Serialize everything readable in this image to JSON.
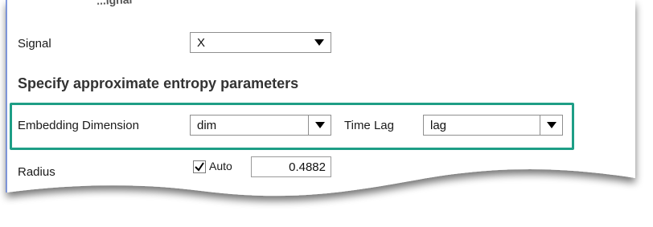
{
  "header": {
    "partial_title": "...ignal"
  },
  "signal": {
    "label": "Signal",
    "value": "X"
  },
  "section": {
    "title": "Specify approximate entropy parameters"
  },
  "embedding": {
    "label": "Embedding Dimension",
    "value": "dim"
  },
  "time_lag": {
    "label": "Time Lag",
    "value": "lag"
  },
  "radius": {
    "label": "Radius",
    "auto_label": "Auto",
    "auto_checked": true,
    "value": "0.4882"
  },
  "colors": {
    "highlight": "#1e9e86",
    "panel_border": "#5b7bd5"
  },
  "icons": {
    "dropdown": "chevron-down-icon",
    "check": "check-icon"
  }
}
